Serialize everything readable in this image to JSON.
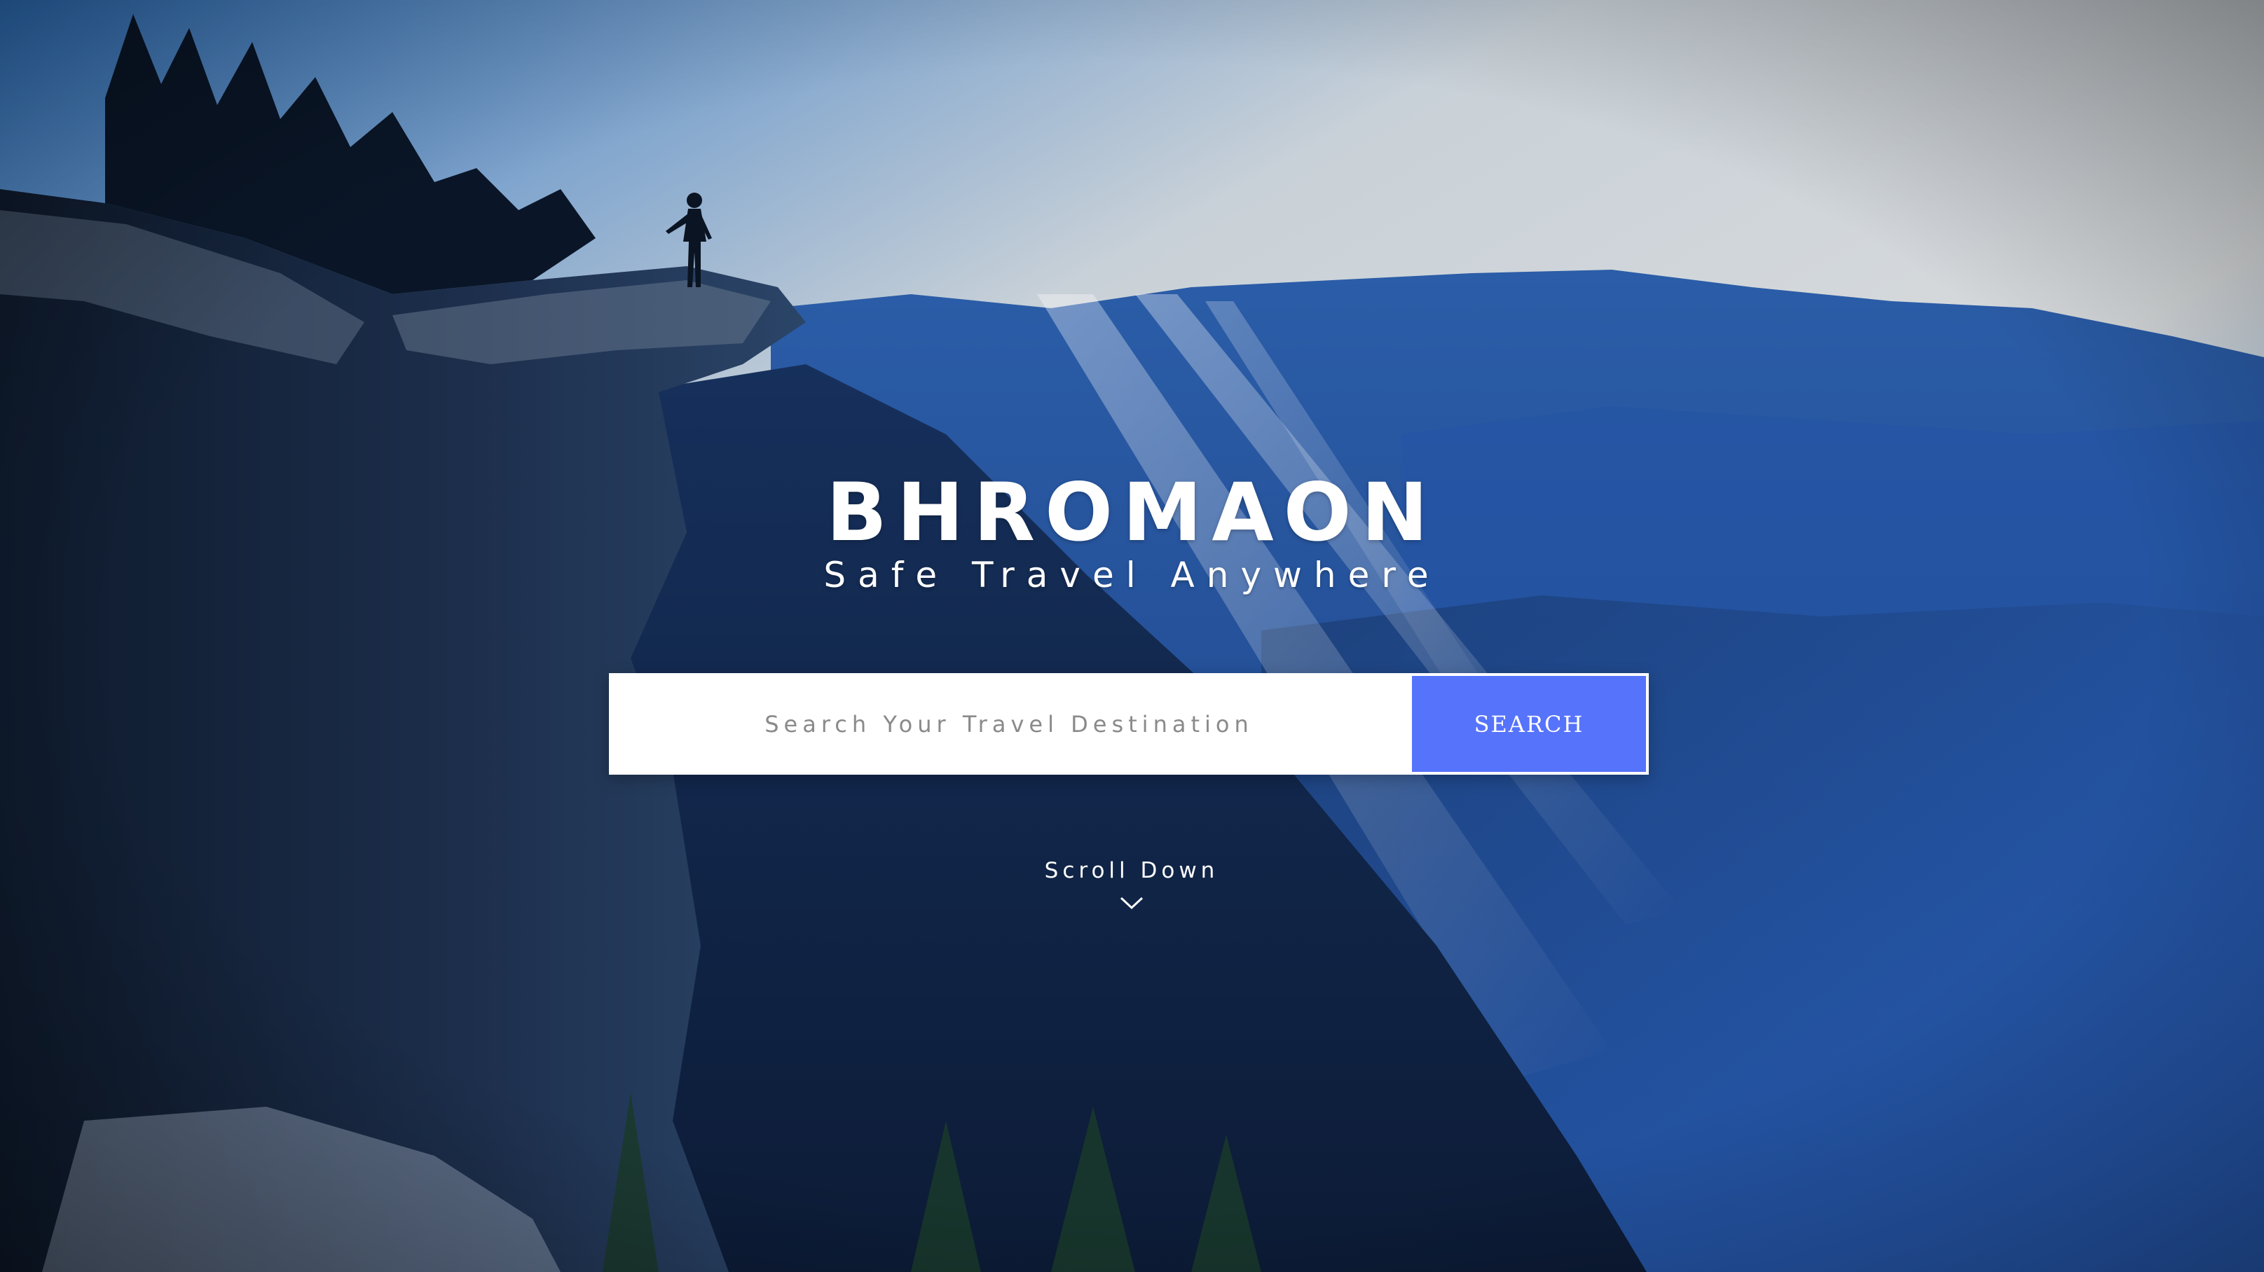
{
  "hero": {
    "title": "BHROMAON",
    "tagline": "Safe Travel Anywhere"
  },
  "search": {
    "placeholder": "Search Your Travel Destination",
    "button_label": "SEARCH"
  },
  "scroll": {
    "label": "Scroll Down",
    "icon": "chevron-down-icon"
  },
  "colors": {
    "accent": "#5673fb",
    "text": "#ffffff",
    "sky_light": "#d3d8dc",
    "mountain_blue": "#2c64c4"
  }
}
